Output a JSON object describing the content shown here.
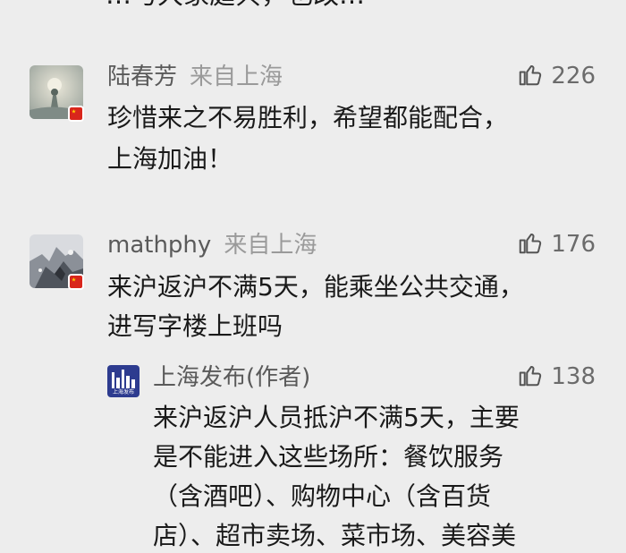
{
  "truncated_top_text": "…与大家庭共，也改…",
  "comments": [
    {
      "username": "陆春芳",
      "location": "来自上海",
      "likes": "226",
      "lines": [
        "珍惜来之不易胜利，希望都能配合，",
        "上海加油！"
      ]
    },
    {
      "username": "mathphy",
      "location": "来自上海",
      "likes": "176",
      "lines": [
        "来沪返沪不满5天，能乘坐公共交通，",
        "进写字楼上班吗"
      ],
      "reply": {
        "username": "上海发布(作者)",
        "avatar_text": "上海发布",
        "likes": "138",
        "lines": [
          "来沪返沪人员抵沪不满5天，主要",
          "是不能进入这些场所：餐饮服务",
          "（含酒吧）、购物中心（含百货",
          "店）、超市卖场、菜市场、美容美"
        ]
      }
    }
  ],
  "icons": {
    "like": "thumbs-up-icon",
    "flag": "china-flag-icon"
  }
}
